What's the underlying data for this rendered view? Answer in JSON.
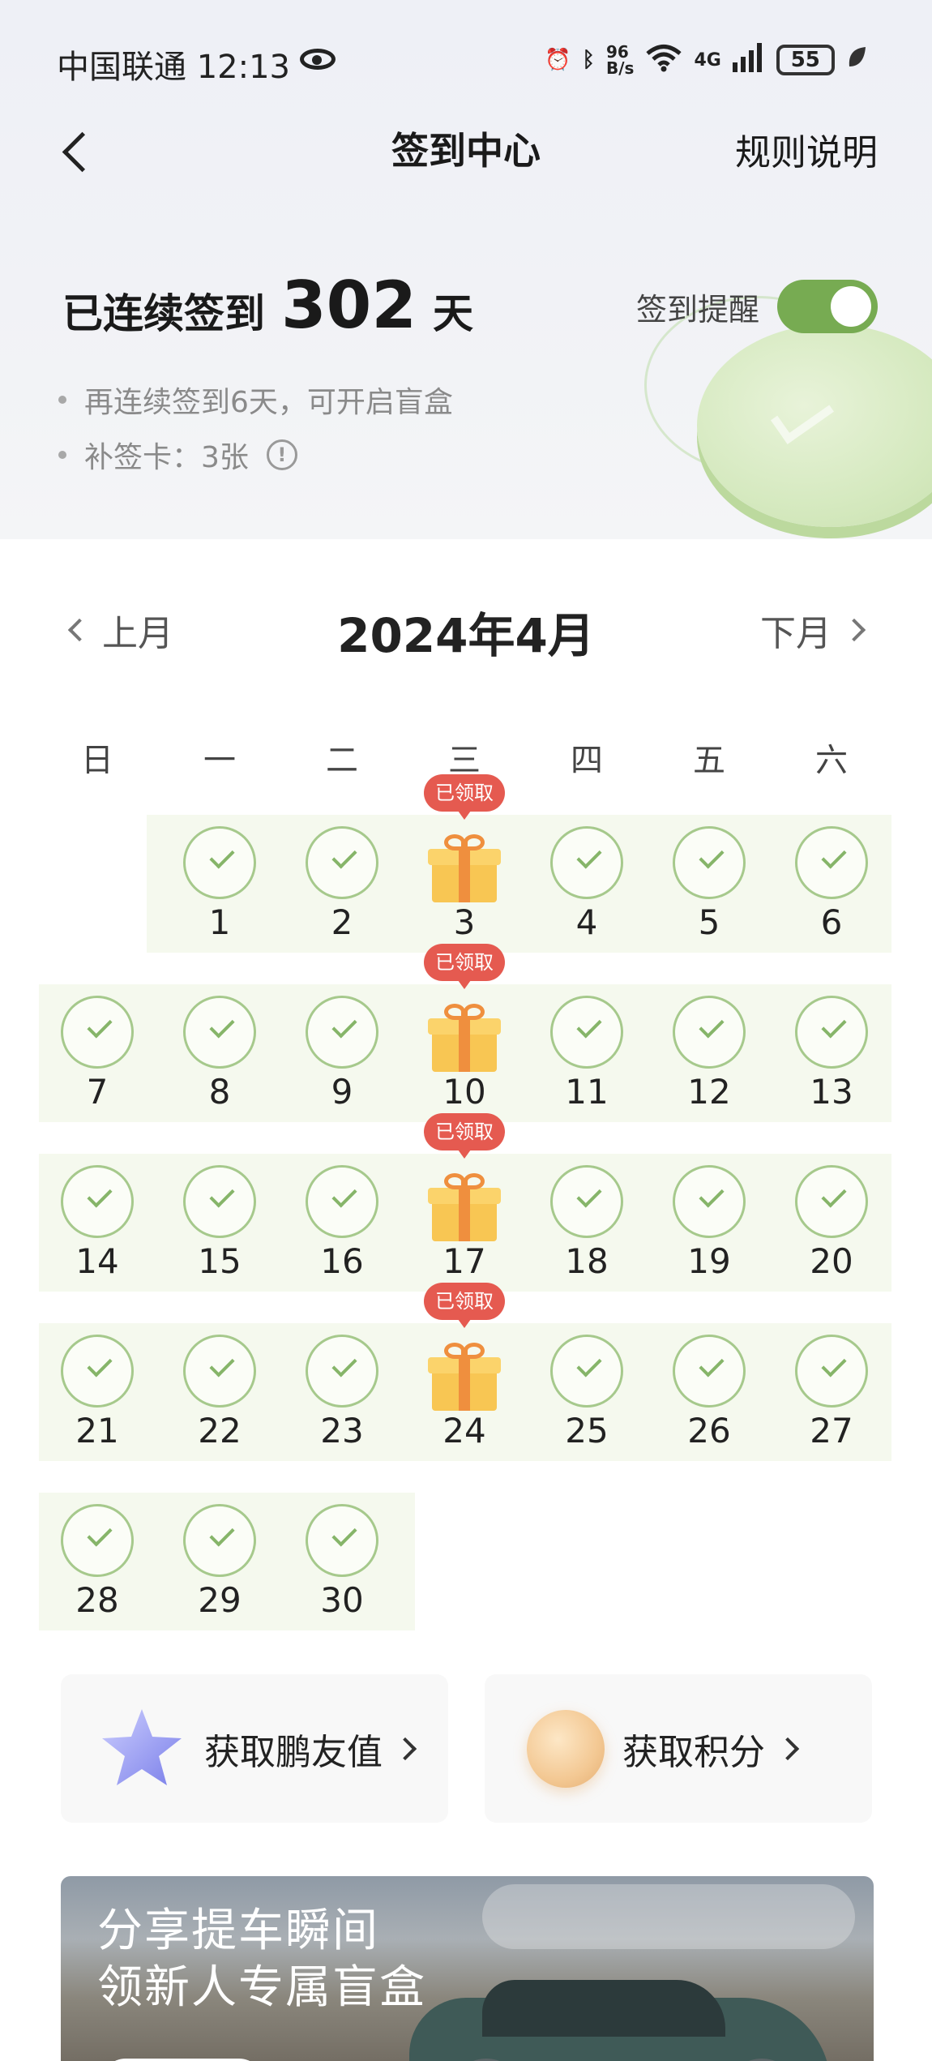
{
  "status_bar": {
    "carrier_time": "中国联通 12:13",
    "net_speed_top": "96",
    "net_speed_unit": "B/s",
    "network": "4G",
    "battery": "55"
  },
  "nav": {
    "title": "签到中心",
    "rules_link": "规则说明"
  },
  "streak": {
    "prefix": "已连续签到",
    "count": "302",
    "suffix": "天",
    "reminder_label": "签到提醒",
    "reminder_on": true
  },
  "info": {
    "blind_box_hint": "再连续签到6天，可开启盲盒",
    "makeup_cards": "补签卡：3张",
    "info_icon": "!"
  },
  "calendar": {
    "prev_label": "上月",
    "next_label": "下月",
    "month_title": "2024年4月",
    "weekdays": [
      "日",
      "一",
      "二",
      "三",
      "四",
      "五",
      "六"
    ],
    "claimed_label": "已领取",
    "first_weekday_index": 1,
    "days_in_month": 30,
    "gift_days": [
      3,
      10,
      17,
      24
    ],
    "checked_days": [
      1,
      2,
      4,
      5,
      6,
      7,
      8,
      9,
      11,
      12,
      13,
      14,
      15,
      16,
      18,
      19,
      20,
      21,
      22,
      23,
      25,
      26,
      27,
      28,
      29,
      30
    ]
  },
  "actions": {
    "friend_value": "获取鹏友值",
    "points": "获取积分"
  },
  "banner": {
    "line1": "分享提车瞬间",
    "line2": "领新人专属盲盒"
  },
  "colors": {
    "accent_green": "#77ab52",
    "check_green": "#86b569",
    "badge_red": "#e55a50",
    "gift_yellow": "#f8c653"
  }
}
